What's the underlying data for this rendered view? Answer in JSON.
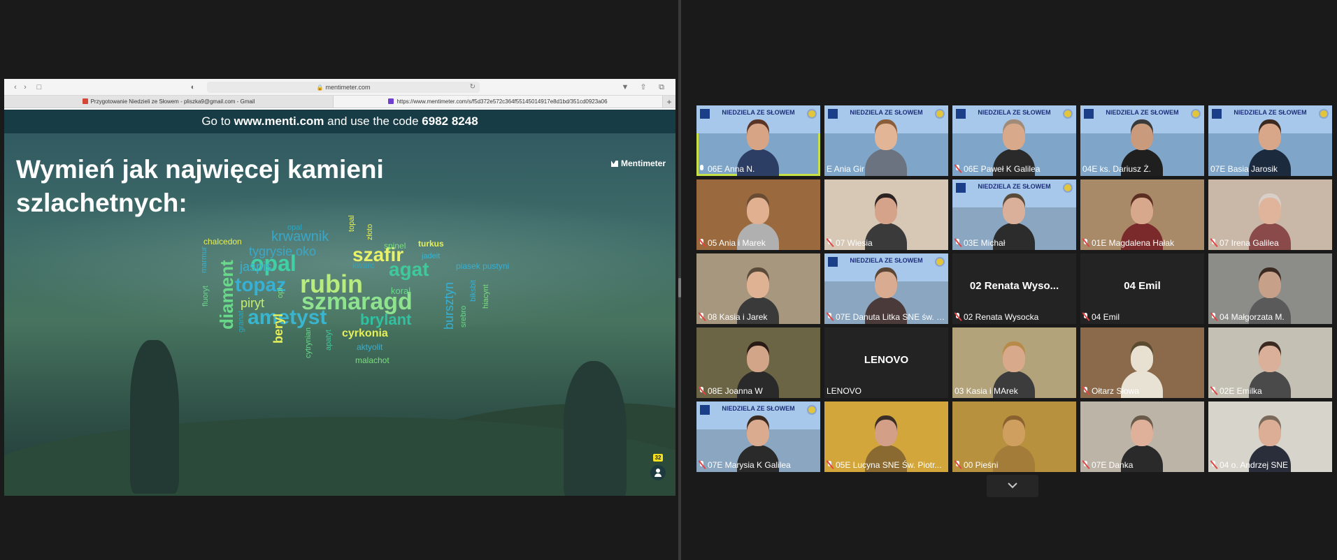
{
  "browser": {
    "url": "mentimeter.com",
    "tabs": [
      {
        "label": "Przygotowanie Niedzieli ze Słowem - pliszka9@gmail.com - Gmail",
        "favicon_color": "#d44638"
      },
      {
        "label": "https://www.mentimeter.com/s/f5d372e572c364f55145014917e8d1bd/351cd0923a06",
        "favicon_color": "#6e3fd1"
      }
    ]
  },
  "slide": {
    "join_prefix": "Go to ",
    "join_url": "www.menti.com",
    "join_middle": " and use the code ",
    "join_code": "6982 8248",
    "brand": "Mentimeter",
    "question": "Wymień jak najwięcej kamieni szlachetnych:",
    "participant_count": "32",
    "words": [
      {
        "text": "opal",
        "color": "#3fd0a6"
      },
      {
        "text": "rubin",
        "color": "#b9ec7e"
      },
      {
        "text": "szmaragd",
        "color": "#8fe38f"
      },
      {
        "text": "ametyst",
        "color": "#3ab5d0"
      },
      {
        "text": "topaz",
        "color": "#36b0d4"
      },
      {
        "text": "szafir",
        "color": "#e9f268"
      },
      {
        "text": "agat",
        "color": "#3fc99a"
      },
      {
        "text": "diament",
        "color": "#6ad88a"
      },
      {
        "text": "brylant",
        "color": "#2fc1a0"
      },
      {
        "text": "krwawnik",
        "color": "#3aa7c8"
      },
      {
        "text": "tygrysie oko",
        "color": "#3aa7c8"
      },
      {
        "text": "jaspis",
        "color": "#3ab0cf"
      },
      {
        "text": "piryt",
        "color": "#c7ec6e"
      },
      {
        "text": "cyrkonia",
        "color": "#e6ef58"
      },
      {
        "text": "bursztyn",
        "color": "#36b0d4"
      },
      {
        "text": "beryl",
        "color": "#e6ef58"
      },
      {
        "text": "chalcedon",
        "color": "#e6ef58"
      },
      {
        "text": "turkus",
        "color": "#e6ef58"
      },
      {
        "text": "spinel",
        "color": "#7bde7e"
      },
      {
        "text": "koral",
        "color": "#6ad88a"
      },
      {
        "text": "kwarc",
        "color": "#2aa6c2"
      },
      {
        "text": "jadeit",
        "color": "#3ab5d0"
      },
      {
        "text": "piasek pustyni",
        "color": "#36b0d4"
      },
      {
        "text": "aktyolit",
        "color": "#36b0d4"
      },
      {
        "text": "malachot",
        "color": "#7bde7e"
      },
      {
        "text": "opal",
        "color": "#2aa6c2"
      },
      {
        "text": "topal",
        "color": "#e6ef58"
      },
      {
        "text": "złoto",
        "color": "#e6ef58"
      },
      {
        "text": "marmur",
        "color": "#3ab0cf"
      },
      {
        "text": "fluoryt",
        "color": "#6ad88a"
      },
      {
        "text": "granat",
        "color": "#2aa6c2"
      },
      {
        "text": "opl",
        "color": "#7bde7e"
      },
      {
        "text": "cytrynian",
        "color": "#6ad88a"
      },
      {
        "text": "apatyt",
        "color": "#3fc99a"
      },
      {
        "text": "biksbit",
        "color": "#36b0d4"
      },
      {
        "text": "srebro",
        "color": "#6ad88a"
      },
      {
        "text": "hiacynt",
        "color": "#7bde7e"
      }
    ]
  },
  "gallery": {
    "participants": [
      {
        "name": "06E Anna N.",
        "muted": false,
        "active": true,
        "banner": true,
        "banner_text": "NIEDZIELA ZE SŁOWEM",
        "bg": "#7fa6c8",
        "skin": "#d7a585",
        "hair": "#5a3424",
        "cloth": "#2c3e63"
      },
      {
        "name": "E Ania Gir",
        "muted": null,
        "banner": true,
        "banner_text": "NIEDZIELA ZE SŁOWEM",
        "bg": "#7fa6c8",
        "skin": "#e2b597",
        "hair": "#8a5e3a",
        "cloth": "#6b7380"
      },
      {
        "name": "06E Paweł K Galilea",
        "muted": true,
        "banner": true,
        "banner_text": "NIEDZIELA ZE SŁOWEM",
        "bg": "#7fa6c8",
        "skin": "#d9a98c",
        "hair": "#a08b78",
        "cloth": "#2a2a2a"
      },
      {
        "name": "04E ks. Dariusz Ż.",
        "muted": null,
        "banner": true,
        "banner_text": "NIEDZIELA ZE SŁOWEM",
        "bg": "#7fa6c8",
        "skin": "#c99a7c",
        "hair": "#3a3a3a",
        "cloth": "#1f1f1f"
      },
      {
        "name": "07E Basia Jarosik",
        "muted": null,
        "banner": true,
        "banner_text": "NIEDZIELA ZE SŁOWEM",
        "bg": "#7fa6c8",
        "skin": "#d8a78a",
        "hair": "#3b2a20",
        "cloth": "#1c2a3d"
      },
      {
        "name": "05 Ania i Marek",
        "muted": true,
        "banner": false,
        "bg": "#9a6a3e",
        "skin": "#e1b090",
        "hair": "#6a4c34",
        "cloth": "#b0b0b0"
      },
      {
        "name": "07 Wiesia",
        "muted": true,
        "banner": false,
        "bg": "#d6c8b5",
        "skin": "#d4a38a",
        "hair": "#2c2222",
        "cloth": "#3a3a3a"
      },
      {
        "name": "03E Michał",
        "muted": true,
        "banner": true,
        "banner_text": "NIEDZIELA ZE SŁOWEM",
        "bg": "#8aa6c0",
        "skin": "#dbb09a",
        "hair": "#5a4a3a",
        "cloth": "#2c2c2c"
      },
      {
        "name": "01E Magdalena Hałak",
        "muted": true,
        "banner": false,
        "bg": "#a88968",
        "skin": "#d8a88c",
        "hair": "#5b2e22",
        "cloth": "#7a2a2a"
      },
      {
        "name": "07 Irena Galilea",
        "muted": true,
        "banner": false,
        "bg": "#c9b7a7",
        "skin": "#dfb49a",
        "hair": "#d8d0c8",
        "cloth": "#8a4a4a"
      },
      {
        "name": "08 Kasia i Jarek",
        "muted": true,
        "banner": false,
        "bg": "#a7977f",
        "skin": "#e0b294",
        "hair": "#5a4a3a",
        "cloth": "#3a3a3a"
      },
      {
        "name": "07E Danuta Litka SNE św. Ka...",
        "muted": true,
        "banner": true,
        "banner_text": "NIEDZIELA ZE SŁOWEM",
        "bg": "#8aa6c0",
        "skin": "#d9ac92",
        "hair": "#5b4636",
        "cloth": "#4a3a3a"
      },
      {
        "name": "02 Renata Wysocka",
        "muted": true,
        "banner": false,
        "center": "02 Renata Wyso...",
        "bg": "#232323"
      },
      {
        "name": "04 Emil",
        "muted": true,
        "banner": false,
        "center": "04 Emil",
        "bg": "#232323"
      },
      {
        "name": "04 Małgorzata M.",
        "muted": true,
        "banner": false,
        "bg": "#8c8c88",
        "skin": "#c7a08a",
        "hair": "#3a2a22",
        "cloth": "#5a5a5a"
      },
      {
        "name": "08E Joanna W",
        "muted": true,
        "banner": false,
        "bg": "#6b6545",
        "skin": "#d2a488",
        "hair": "#2a1a16",
        "cloth": "#2a2a2a"
      },
      {
        "name": "LENOVO",
        "muted": null,
        "banner": false,
        "center": "LENOVO",
        "bg": "#232323"
      },
      {
        "name": "03 Kasia i MArek",
        "muted": null,
        "banner": false,
        "bg": "#b3a37b",
        "skin": "#d9a98b",
        "hair": "#b88a4a",
        "cloth": "#3c3c3c"
      },
      {
        "name": "Ołtarz Słowa",
        "muted": true,
        "banner": false,
        "bg": "#8a6a4a",
        "skin": "#e8e0d0",
        "hair": "#5a4a30",
        "cloth": "#e8e2d5"
      },
      {
        "name": "02E Emilka",
        "muted": true,
        "banner": false,
        "bg": "#c4c0b3",
        "skin": "#dbb09a",
        "hair": "#3b2a20",
        "cloth": "#4a4a4a"
      },
      {
        "name": "07E Marysia K Galilea",
        "muted": true,
        "banner": true,
        "banner_text": "NIEDZIELA ZE SŁOWEM",
        "bg": "#8aa6c0",
        "skin": "#dbab90",
        "hair": "#3a2a20",
        "cloth": "#2a2a2a"
      },
      {
        "name": "05E Lucyna SNE Św. Piotr...",
        "muted": true,
        "banner": false,
        "bg": "#d2a63a",
        "skin": "#d3a087",
        "hair": "#3b2e26",
        "cloth": "#8a6a30"
      },
      {
        "name": "00 Pieśni",
        "muted": true,
        "banner": false,
        "bg": "#b8913f",
        "skin": "#cf9f5f",
        "hair": "#8a6230",
        "cloth": "#a47c3a"
      },
      {
        "name": "07E Danka",
        "muted": true,
        "banner": false,
        "bg": "#bdb4a8",
        "skin": "#dfb19a",
        "hair": "#6a5a4a",
        "cloth": "#2a2a2a"
      },
      {
        "name": "04 o. Andrzej SNE",
        "muted": true,
        "banner": false,
        "bg": "#d7d4cc",
        "skin": "#dbae95",
        "hair": "#7a6a5a",
        "cloth": "#2a2e3a"
      }
    ]
  }
}
